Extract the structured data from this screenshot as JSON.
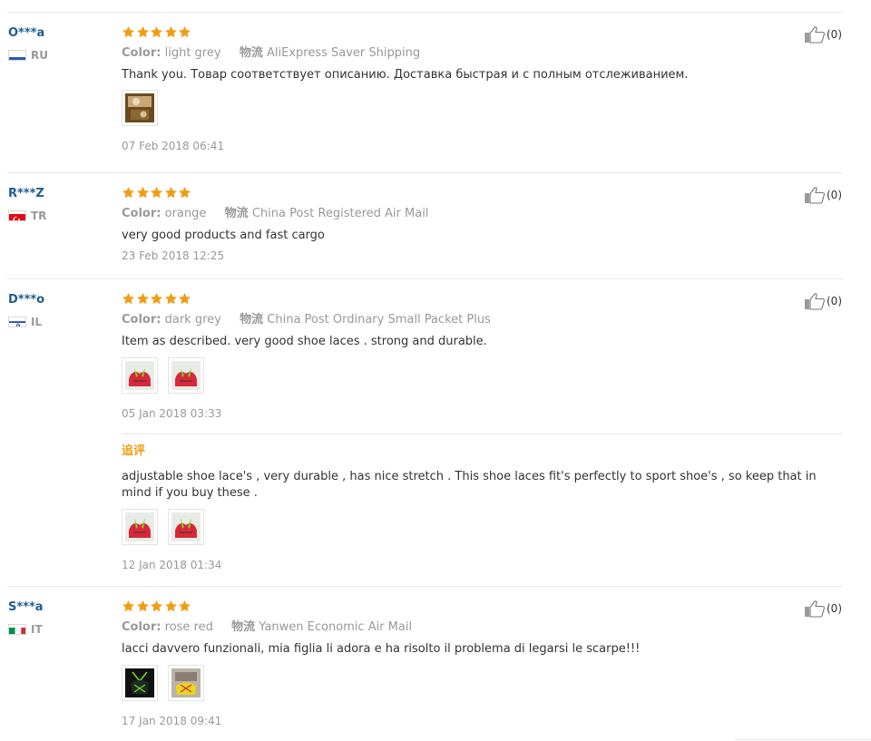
{
  "colors": {
    "username": "#1f5b94",
    "star": "#f39c12",
    "meta": "#999999",
    "additional_label": "#f39c12",
    "divider": "#e6e6e6"
  },
  "icons": {
    "star": "star-icon",
    "helpful": "thumbs-up-icon",
    "flag": "country-flag-icon"
  },
  "reviews": [
    {
      "username": "O***a",
      "country": "RU",
      "rating": 5,
      "color_label": "Color:",
      "color_value": "light grey",
      "logistics_label": "物流",
      "logistics_value": "AliExpress Saver Shipping",
      "text": "Thank you. Товар соответствует описанию. Доставка быстрая и с полным отслеживанием.",
      "date": "07 Feb 2018 06:41",
      "helpful_count": "(0)"
    },
    {
      "username": "R***Z",
      "country": "TR",
      "rating": 5,
      "color_label": "Color:",
      "color_value": "orange",
      "logistics_label": "物流",
      "logistics_value": "China Post Registered Air Mail",
      "text": "very good products and fast cargo",
      "date": "23 Feb 2018 12:25",
      "helpful_count": "(0)"
    },
    {
      "username": "D***o",
      "country": "IL",
      "rating": 5,
      "color_label": "Color:",
      "color_value": "dark grey",
      "logistics_label": "物流",
      "logistics_value": "China Post Ordinary Small Packet Plus",
      "text": "Item as described. very good shoe laces . strong and durable.",
      "date": "05 Jan 2018 03:33",
      "helpful_count": "(0)",
      "additional": {
        "label": "追评",
        "text": "adjustable shoe lace's , very durable , has nice stretch . This shoe laces fit's perfectly to sport shoe's , so keep that in mind if you buy these .",
        "date": "12 Jan 2018 01:34"
      }
    },
    {
      "username": "S***a",
      "country": "IT",
      "rating": 5,
      "color_label": "Color:",
      "color_value": "rose red",
      "logistics_label": "物流",
      "logistics_value": "Yanwen Economic Air Mail",
      "text": "lacci davvero funzionali, mia figlia li adora e ha risolto il problema di legarsi le scarpe!!!",
      "date": "17 Jan 2018 09:41",
      "helpful_count": "(0)"
    }
  ]
}
